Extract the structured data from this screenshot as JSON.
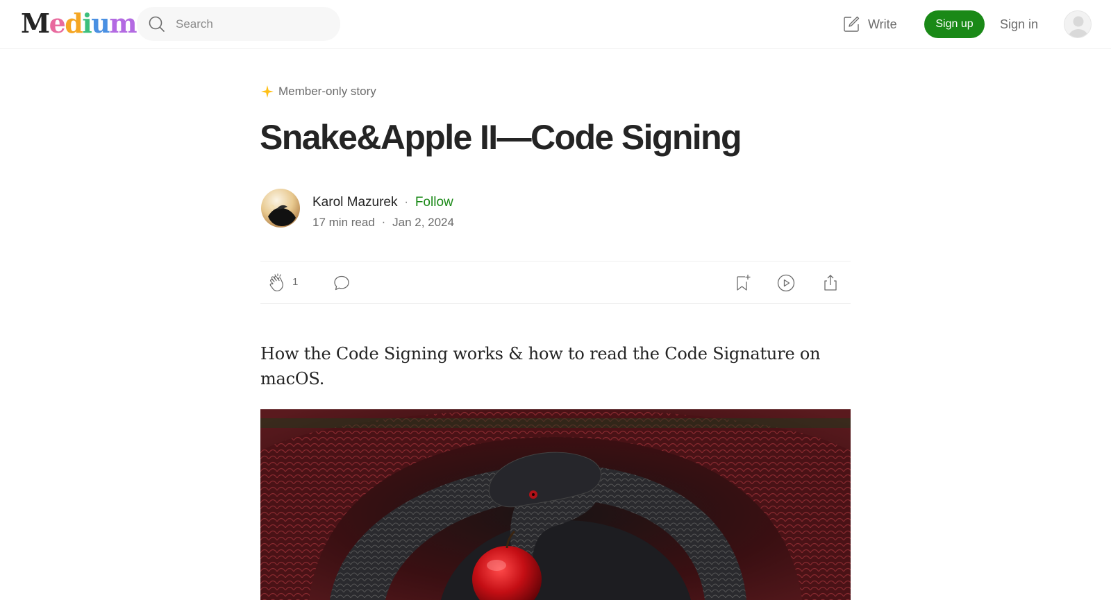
{
  "header": {
    "logo_text": "Medium",
    "logo_letters": [
      "M",
      "e",
      "d",
      "i",
      "u",
      "m"
    ],
    "logo_colors": [
      "#242424",
      "#e86a9e",
      "#f5a623",
      "#3cbf7c",
      "#4a90e2",
      "#b36ae2"
    ],
    "search_placeholder": "Search",
    "write_label": "Write",
    "signup_label": "Sign up",
    "signin_label": "Sign in"
  },
  "article": {
    "badge": "Member-only story",
    "title": "Snake&Apple II—Code Signing",
    "author": "Karol Mazurek",
    "follow_label": "Follow",
    "read_time": "17 min read",
    "date": "Jan 2, 2024",
    "clap_count": "1",
    "subtitle": "How the Code Signing works & how to read the Code Signature on macOS."
  },
  "colors": {
    "brand_green": "#1a8917",
    "star_gold": "#ffc017",
    "text_primary": "#242424",
    "text_secondary": "#6b6b6b"
  }
}
